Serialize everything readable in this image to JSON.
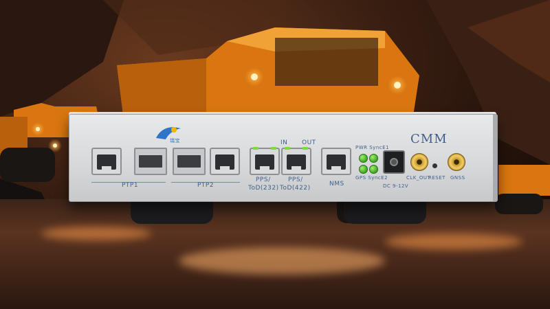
{
  "device": {
    "brand_text": "瑞宝",
    "model": "CMM",
    "top_labels": {
      "in": "IN",
      "out": "OUT"
    },
    "groups": [
      {
        "label": "PTP1"
      },
      {
        "label": "PTP2"
      }
    ],
    "port_labels": {
      "pps_232_line1": "PPS/",
      "pps_232_line2": "ToD(232)",
      "pps_422_line1": "PPS/",
      "pps_422_line2": "ToD(422)",
      "nms": "NMS"
    },
    "led_labels": {
      "top": "PWR SyncE1",
      "bottom": "GPS SyncE2"
    },
    "dc_label": "DC 9-12V",
    "connector_labels": {
      "clk_out": "CLK_OUT",
      "reset": "RESET",
      "gnss": "GNSS"
    }
  },
  "colors": {
    "label_blue": "#3f5f8a",
    "led_green": "#6ed83a",
    "truck_orange": "#e58a16"
  }
}
